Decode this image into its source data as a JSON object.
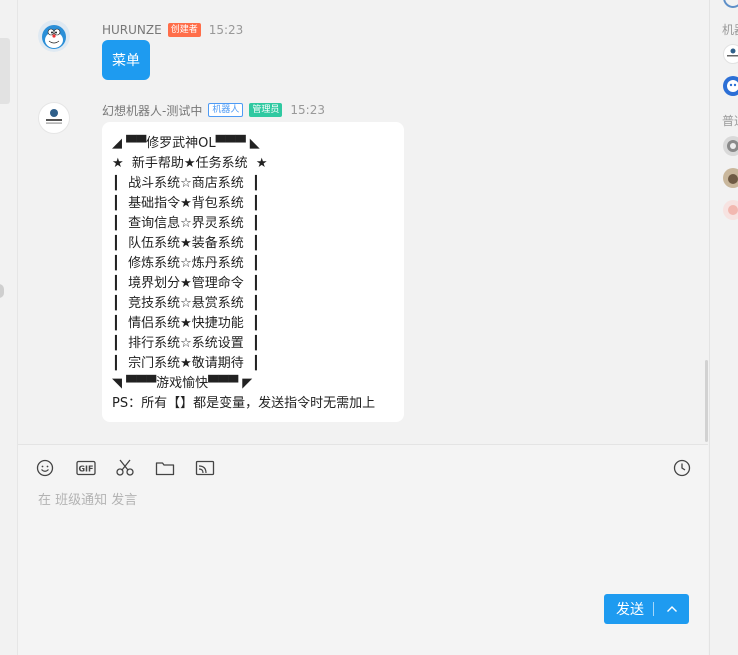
{
  "right_panel": {
    "heading_1": "机器",
    "heading_2": "普通"
  },
  "messages": [
    {
      "sender": "HURUNZE",
      "badge": "创建者",
      "time": "15:23",
      "text": "菜单"
    },
    {
      "sender": "幻想机器人-测试中",
      "badge_robot": "机器人",
      "badge_admin": "管理员",
      "time": "15:23",
      "lines": [
        "◢ ▀▀修罗武神OL▀▀▀ ◣",
        "★  新手帮助★任务系统  ★",
        "┃  战斗系统☆商店系统  ┃",
        "┃  基础指令★背包系统  ┃",
        "┃  查询信息☆界灵系统  ┃",
        "┃  队伍系统★装备系统  ┃",
        "┃  修炼系统☆炼丹系统  ┃",
        "┃  境界划分★管理命令  ┃",
        "┃  竞技系统☆悬赏系统  ┃",
        "┃  情侣系统★快捷功能  ┃",
        "┃  排行系统☆系统设置  ┃",
        "┃  宗门系统★敬请期待  ┃",
        "◥ ▀▀▀游戏愉快▀▀▀ ◤",
        "PS：所有【】都是变量，发送指令时无需加上"
      ]
    }
  ],
  "toolbar": {
    "icons": [
      "emoji-icon",
      "gif-icon",
      "scissors-icon",
      "folder-icon",
      "screen-share-icon",
      "history-icon"
    ],
    "placeholder": "在 班级通知 发言",
    "send_label": "发送"
  },
  "colors": {
    "accent": "#1e9bf0",
    "creator_badge": "#ff6e4a",
    "robot_badge": "#4e9bf5",
    "admin_badge": "#2fc9a1"
  }
}
